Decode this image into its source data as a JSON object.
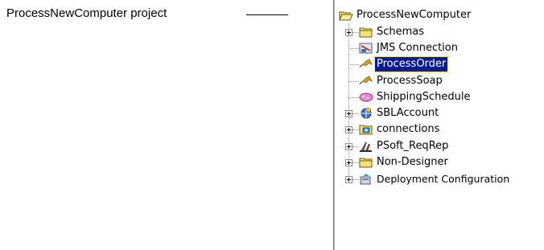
{
  "annotation": {
    "text": "ProcessNewComputer project"
  },
  "tree": {
    "root": {
      "label": "ProcessNewComputer",
      "icon": "folder-open-icon",
      "expanded": true
    },
    "items": [
      {
        "label": "Schemas",
        "icon": "folder-icon",
        "expandable": true,
        "selected": false
      },
      {
        "label": "JMS Connection",
        "icon": "jms-connection-icon",
        "expandable": false,
        "selected": false
      },
      {
        "label": "ProcessOrder",
        "icon": "process-icon",
        "expandable": false,
        "selected": true
      },
      {
        "label": "ProcessSoap",
        "icon": "process-icon",
        "expandable": false,
        "selected": false
      },
      {
        "label": "ShippingSchedule",
        "icon": "soap-icon",
        "expandable": false,
        "selected": false
      },
      {
        "label": "SBLAccount",
        "icon": "siebel-adapter-icon",
        "expandable": true,
        "selected": false
      },
      {
        "label": "connections",
        "icon": "connections-folder-icon",
        "expandable": true,
        "selected": false
      },
      {
        "label": "PSoft_ReqRep",
        "icon": "peoplesoft-adapter-icon",
        "expandable": true,
        "selected": false
      },
      {
        "label": "Non-Designer",
        "icon": "folder-icon",
        "expandable": true,
        "selected": false
      },
      {
        "label": "Deployment Configuration",
        "icon": "deployment-icon",
        "expandable": true,
        "selected": false
      }
    ]
  },
  "colors": {
    "selection": "#0b1a8c",
    "selection_outline": "#ffd400",
    "folder": "#f7e27a",
    "process": "#c79a1e"
  }
}
